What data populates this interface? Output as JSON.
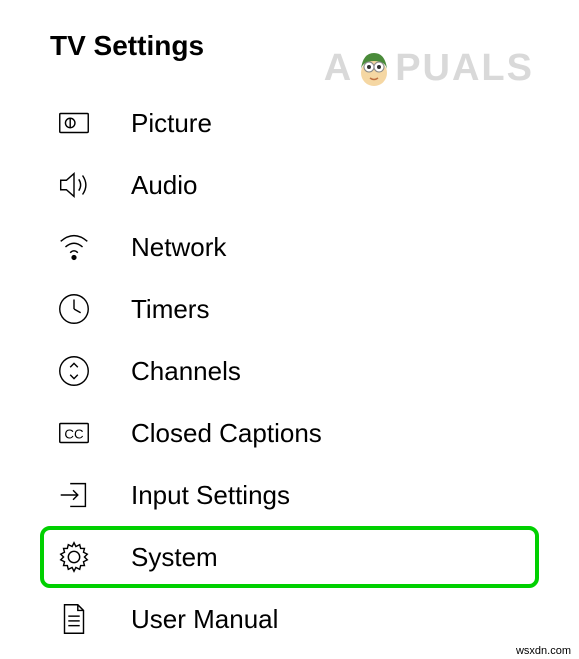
{
  "title": "TV Settings",
  "watermark": {
    "prefix": "A",
    "suffix": "PUALS"
  },
  "menu": {
    "items": [
      {
        "label": "Picture",
        "icon": "picture-icon",
        "highlighted": false
      },
      {
        "label": "Audio",
        "icon": "audio-icon",
        "highlighted": false
      },
      {
        "label": "Network",
        "icon": "network-icon",
        "highlighted": false
      },
      {
        "label": "Timers",
        "icon": "timers-icon",
        "highlighted": false
      },
      {
        "label": "Channels",
        "icon": "channels-icon",
        "highlighted": false
      },
      {
        "label": "Closed Captions",
        "icon": "closed-captions-icon",
        "highlighted": false
      },
      {
        "label": "Input Settings",
        "icon": "input-settings-icon",
        "highlighted": false
      },
      {
        "label": "System",
        "icon": "system-icon",
        "highlighted": true
      },
      {
        "label": "User Manual",
        "icon": "user-manual-icon",
        "highlighted": false
      }
    ]
  },
  "credit": "wsxdn.com"
}
